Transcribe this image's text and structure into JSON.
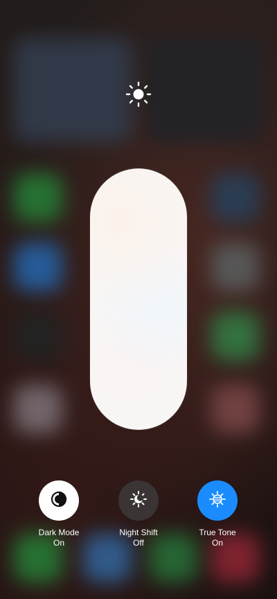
{
  "brightness": {
    "icon": "sun-icon",
    "level_percent": 100
  },
  "toggles": [
    {
      "label": "Dark Mode",
      "state": "On",
      "icon": "dark-mode-icon",
      "bg": "#ffffff"
    },
    {
      "label": "Night Shift",
      "state": "Off",
      "icon": "night-shift-icon",
      "bg": "#3a3434"
    },
    {
      "label": "True Tone",
      "state": "On",
      "icon": "true-tone-icon",
      "bg": "#1a8cff"
    }
  ]
}
